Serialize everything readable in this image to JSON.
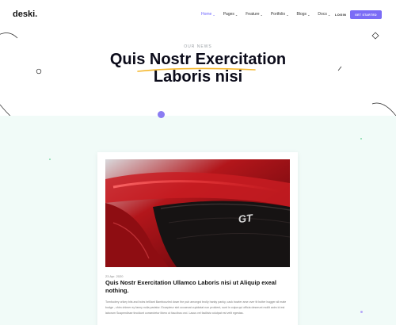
{
  "brand": {
    "logo": "deski."
  },
  "nav": {
    "items": [
      {
        "label": "Home",
        "active": true,
        "dropdown": true
      },
      {
        "label": "Pages",
        "active": false,
        "dropdown": true
      },
      {
        "label": "Feature",
        "active": false,
        "dropdown": true
      },
      {
        "label": "Portfolio",
        "active": false,
        "dropdown": true
      },
      {
        "label": "Blogs",
        "active": false,
        "dropdown": true
      },
      {
        "label": "Docs",
        "active": false,
        "dropdown": true
      }
    ],
    "chevron": "⌄",
    "login_label": "LOGIN",
    "cta_label": "GET STARTED"
  },
  "hero": {
    "eyebrow": "OUR NEWS",
    "title_line1": "Quis Nostr Exercitation",
    "title_line2": "Laboris nisi"
  },
  "post": {
    "image_text": "GT",
    "date": "23 Apr. 2020",
    "title": "Quis Nostr Exercitation Ullamco Laboris nisi ut Aliquip exeal nothing.",
    "excerpt": "Tomfoolery crikey bits and bobs brilliant Bamboozled down the pub amongst brolly hanky panky, cack bowler arse over tit butter bugger all mate bodge , chim chimer ey fanny nulla pariatur. Excepteur sint occaecat cupidatat non proident, sunt in culpa qui officia deserunt mollit anim id est laborum Suspendisse tincidunt consectetur libero ut faucibus orci. Lacus vel facilisis volutpat est velit egestas."
  },
  "colors": {
    "accent": "#7b6cf6",
    "underline": "#f5b82e",
    "lower_bg": "#f1fbf8"
  }
}
